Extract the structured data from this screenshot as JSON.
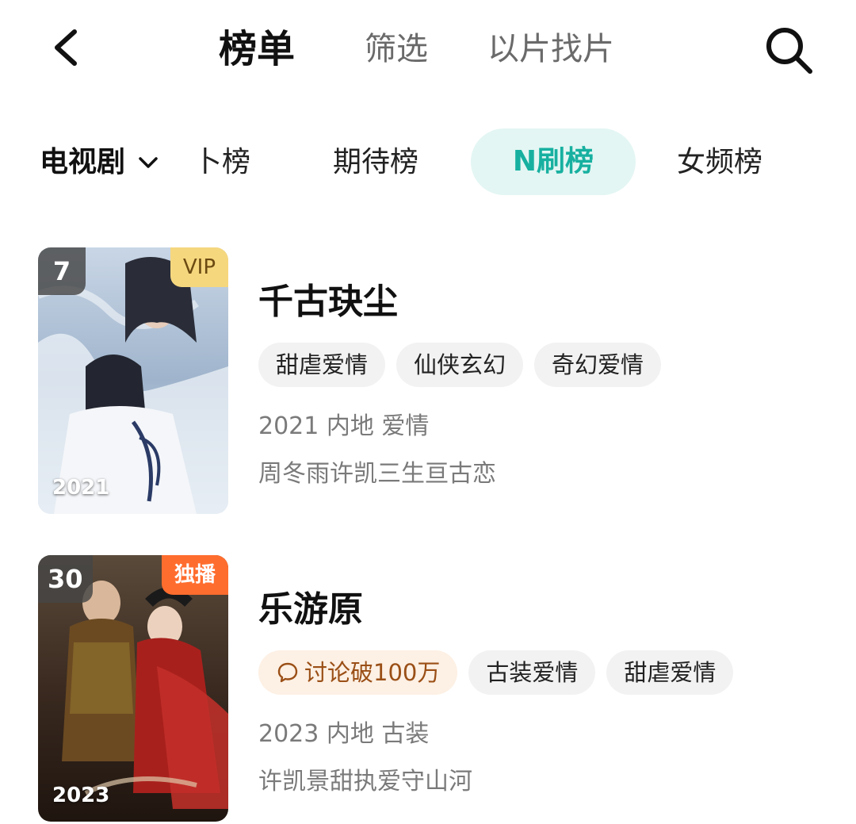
{
  "topnav": {
    "tabs": [
      "榜单",
      "筛选",
      "以片找片"
    ]
  },
  "category": {
    "selected": "电视剧",
    "rank_tabs": [
      "卜榜",
      "期待榜",
      "N刷榜",
      "女频榜"
    ],
    "active_rank_tab": "N刷榜"
  },
  "colors": {
    "accent": "#17b0a0",
    "accent_bg": "#e3f6f3",
    "vip_badge": "#f5d77e",
    "exclusive_badge": "#ff6d2e"
  },
  "items": [
    {
      "rank": "7",
      "badge": "VIP",
      "poster_year": "2021",
      "title": "千古玦尘",
      "tags": [
        "甜虐爱情",
        "仙侠玄幻",
        "奇幻爱情"
      ],
      "meta": "2021 内地 爱情",
      "desc": "周冬雨许凯三生亘古恋"
    },
    {
      "rank": "30",
      "badge": "独播",
      "poster_year": "2023",
      "title": "乐游原",
      "hot_tag": "讨论破100万",
      "tags": [
        "古装爱情",
        "甜虐爱情"
      ],
      "meta": "2023 内地 古装",
      "desc": "许凯景甜执爱守山河"
    }
  ]
}
